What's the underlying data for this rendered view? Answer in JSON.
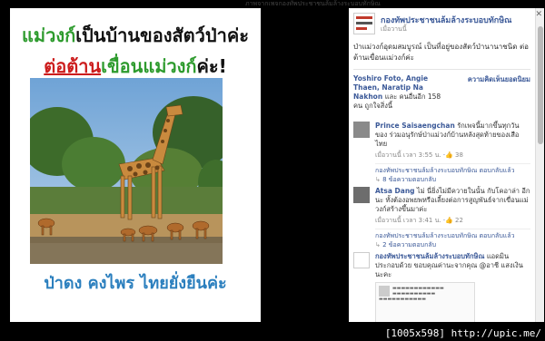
{
  "top_hint": "ภาพจากเพจกองทัพประชาชนล้มล้างระบอบทักษิณ",
  "poster": {
    "line1_green": "แม่วงก์",
    "line1_black": "เป็นบ้านของสัตว์ป่าค่ะ",
    "line2_red": "ต่อต้าน",
    "line2_green": "เขื่อนแม่วงก์",
    "line2_black": "ค่ะ!",
    "line3": "ป่าดง คงไพร ไทยยั่งยืนค่ะ"
  },
  "post": {
    "page_name": "กองทัพประชาชนล้มล้างระบอบทักษิณ",
    "time": "เมื่อวานนี้",
    "caption": "ป่าแม่วงก์อุดมสมบูรณ์ เป็นที่อยู่ของสัตว์ป่านานาชนิด ต่อต้านเขื่อนแม่วงก์ค่ะ"
  },
  "likes": {
    "names": "Yoshiro Foto, Angie Thaen, Naratip Na Nakhon",
    "and_others": "และ คนอื่นอีก 158 คน ถูกใจสิ่งนี้",
    "sort": "ความคิดเห็นยอดนิยม"
  },
  "comments": [
    {
      "name": "Prince Saisaengchan",
      "text": "รักเพจนี้มากขึ้นทุกวันของ ร่วมอนุรักษ์ป่าแม่วงก์บ้านหลังสุดท้ายของเสือไทย",
      "time": "เมื่อวานนี้ เวลา 3:55 น.",
      "likes": "38",
      "reply_author": "กองทัพประชาชนล้มล้างระบอบทักษิณ",
      "reply_label": "ตอบกลับแล้ว",
      "reply_count": "8 ข้อความตอบกลับ"
    },
    {
      "name": "Atsa Dang",
      "text": "ไม่ นี่ยิ่งไม่มีควายในนั้น กับโคอาล่า อีกนะ ทั้งต้องอพยพหรือเลี้ยงต่อการสูญพันธ์จากเขื่อนแม่วงก์สร้างขึ้นมาค่ะ",
      "time": "เมื่อวานนี้ เวลา 3:41 น.",
      "likes": "22",
      "reply_author": "กองทัพประชาชนล้มล้างระบอบทักษิณ",
      "reply_label": "ตอบกลับแล้ว",
      "reply_count": "2 ข้อความตอบกลับ"
    },
    {
      "name": "กองทัพประชาชนล้มล้างระบอบทักษิณ",
      "text": "แอดมินประกอบด้วย ขอบคุณค่านะจากคุณ @อาชี แสงเงินนะคะ"
    }
  ],
  "footer": "[1005x598] http://upic.me/",
  "colors": {
    "fb_blue": "#3b5998",
    "poster_green": "#2e9b2e",
    "poster_red": "#cc1d1d",
    "poster_blue": "#2b7fbe"
  }
}
